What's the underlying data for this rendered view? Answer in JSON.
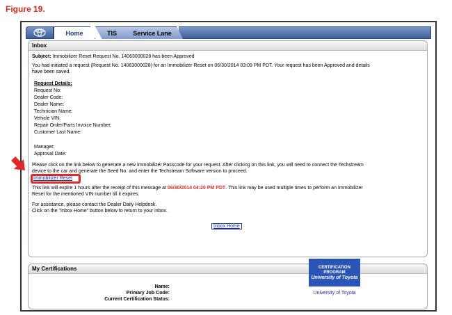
{
  "figure_label": "Figure 19.",
  "tabs": {
    "home": "Home",
    "tis": "TIS",
    "service_lane": "Service Lane"
  },
  "inbox": {
    "title": "Inbox",
    "subject_label": "Subject:",
    "subject_text": "Immobilizer Reset Request No. 14063000028 has been Approved",
    "intro_line1": "You had initiated a request (Request No. 14063000028) for an Immobilizer Reset on 06/30/2014 03:09 PM PDT. Your request has been Approved and details",
    "intro_line2": "have been saved.",
    "request_details_title": "Request Details:",
    "fields": [
      "Request No:",
      "Dealer Code:",
      "Dealer Name:",
      "Technician Name:",
      "Vehicle VIN:",
      "Repair Order/Parts Invoice Number:",
      "Customer Last Name:"
    ],
    "fields2": [
      "Manager:",
      "Approval Date:"
    ],
    "instructions_line1": "Please click on the link below to generate a new Immobilizer Passcode for your request. After clicking on this link, you will need to connect the Techstream",
    "instructions_line2": "device to the car and generate the Seed No. and enter the Techstream Software version to proceed.",
    "reset_link": "Immobilizer Reset",
    "expire_pre": "This link will expire 1 hours after the receipt of this message at ",
    "expire_time": "06/30/2014 04:20 PM PDT",
    "expire_post": ". This link may be used multiple times to perform an Immobilizer",
    "expire_line2": "Reset for the mentioned VIN number till it expires.",
    "assist_line1": "For assistance, please contact the Dealer Daily Helpdesk.",
    "assist_line2": "Click on the \"Inbox Home\" button below to return to your inbox.",
    "inbox_home_button": "Inbox Home"
  },
  "certifications": {
    "title": "My Certifications",
    "name_label": "Name:",
    "job_code_label": "Primary Job Code:",
    "status_label": "Current Certification Status:",
    "logo_line1": "CERTIFICATION",
    "logo_line2": "PROGRAM",
    "logo_line3": "University of Toyota",
    "caption": "University of Toyota"
  },
  "colors": {
    "accent_red": "#e02a2a",
    "link_blue": "#1a2a9c",
    "tab_blue": "#3e5f99"
  },
  "icons": {
    "logo": "toyota-logo-icon",
    "arrow": "red-arrow-icon"
  }
}
